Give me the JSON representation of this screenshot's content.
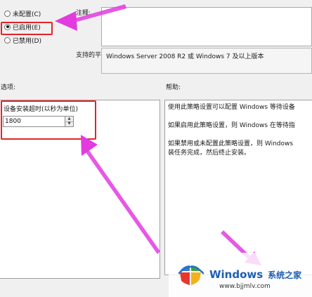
{
  "radio_options": [
    {
      "label": "未配置(C)",
      "checked": false
    },
    {
      "label": "已启用(E)",
      "checked": true
    },
    {
      "label": "已禁用(D)",
      "checked": false
    }
  ],
  "comment": {
    "label": "注释:",
    "value": ""
  },
  "platform": {
    "label": "支持的平台:",
    "value": "Windows Server 2008 R2 或 Windows 7 及以上版本"
  },
  "options": {
    "label": "选项:",
    "setting_label": "设备安装超时(以秒为单位)",
    "timeout_value": "1800"
  },
  "help": {
    "label": "帮助:",
    "paragraphs": [
      "使用此策略设置可以配置 Windows 等待设备",
      "如果启用此策略设置，则 Windows 在等待指",
      "如果禁用或未配置此策略设置，则 Windows",
      "装任务完成，然后终止安装。"
    ]
  },
  "watermark": {
    "brand": "Windows",
    "suffix": "系统之家",
    "url": "www.bjjmlv.com"
  },
  "colors": {
    "highlight_red": "#e0242a",
    "arrow_magenta": "#e23be0"
  }
}
